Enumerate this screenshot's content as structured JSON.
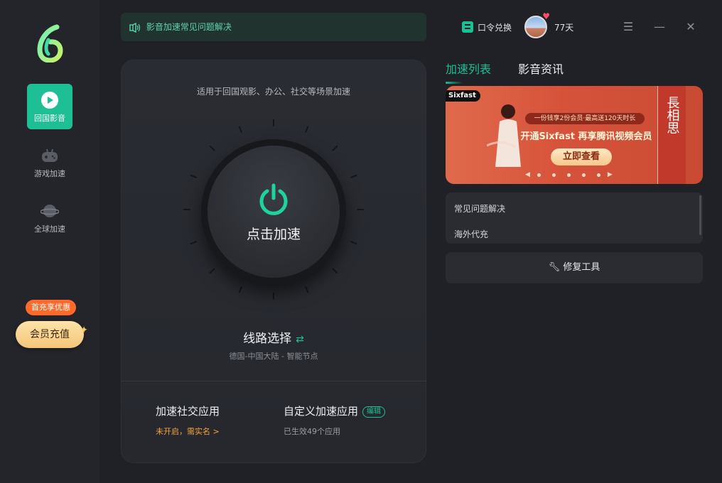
{
  "sidebar": {
    "items": [
      {
        "label": "回国影音",
        "icon": "play-icon",
        "active": true
      },
      {
        "label": "游戏加速",
        "icon": "gamepad-icon",
        "active": false
      },
      {
        "label": "全球加速",
        "icon": "planet-icon",
        "active": false
      }
    ],
    "promo_badge": "首充享优惠",
    "vip_button": "会员充值"
  },
  "header": {
    "faq_text": "影音加速常见问题解决",
    "redeem_label": "口令兑换",
    "days_left": "77天",
    "window_controls": [
      "menu-icon",
      "minimize-icon",
      "close-icon"
    ]
  },
  "main": {
    "subtitle": "适用于回国观影、办公、社交等场景加速",
    "knob_label": "点击加速",
    "route_title": "线路选择",
    "route_sub": "德国-中国大陆 - 智能节点",
    "social": {
      "title": "加速社交应用",
      "status": "未开启，需实名 >"
    },
    "custom": {
      "title": "自定义加速应用",
      "edit": "编辑",
      "status": "已生效49个应用"
    }
  },
  "right": {
    "tabs": [
      {
        "label": "加速列表",
        "active": true
      },
      {
        "label": "影音资讯",
        "active": false
      }
    ],
    "banner": {
      "brand": "Sixfast",
      "tag": "一份钱享2份会员·最高送120天时长",
      "headline": "开通Sixfast 再享腾讯视频会员",
      "cta": "立即查看",
      "side_text": "長相思"
    },
    "faq_items": [
      "常见问题解决",
      "海外代充"
    ],
    "repair_label": "修复工具"
  },
  "colors": {
    "accent": "#1fbf95",
    "promo": "#ff6a2b",
    "warning": "#f2a43a"
  }
}
